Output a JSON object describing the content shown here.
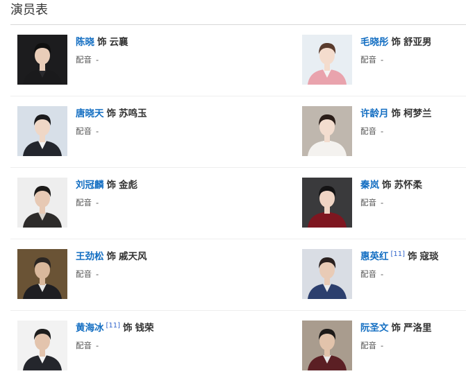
{
  "heading": "演员表",
  "voice_label": "配音",
  "plays_label": "饰",
  "cast": [
    {
      "actor": "陈晓",
      "ref": "",
      "character": "云襄",
      "voice": "-",
      "photo": {
        "bg": "#1c1c1e",
        "hair": "#0f0f0f",
        "skin": "#e9cdb9",
        "outfit": "#1a1a1c",
        "shirt": "#2a2a2e"
      }
    },
    {
      "actor": "毛晓彤",
      "ref": "",
      "character": "舒亚男",
      "voice": "-",
      "photo": {
        "bg": "#e8eef3",
        "hair": "#5a3c2e",
        "skin": "#f4dccd",
        "outfit": "#e9a3ad",
        "shirt": "#f4f4f4"
      }
    },
    {
      "actor": "唐晓天",
      "ref": "",
      "character": "苏鸣玉",
      "voice": "-",
      "photo": {
        "bg": "#d7dfe8",
        "hair": "#1b1b1d",
        "skin": "#efd7c6",
        "outfit": "#23262d",
        "shirt": "#f2f2f2"
      }
    },
    {
      "actor": "许龄月",
      "ref": "",
      "character": "柯梦兰",
      "voice": "-",
      "photo": {
        "bg": "#bfb7ae",
        "hair": "#2a1d18",
        "skin": "#f3ddcf",
        "outfit": "#f4f2ef",
        "shirt": "#f4f2ef"
      }
    },
    {
      "actor": "刘冠麟",
      "ref": "",
      "character": "金彪",
      "voice": "-",
      "photo": {
        "bg": "#eeeeee",
        "hair": "#1c1a19",
        "skin": "#e7c9b4",
        "outfit": "#2d2b2a",
        "shirt": "#d9d3cb"
      }
    },
    {
      "actor": "秦岚",
      "ref": "",
      "character": "苏怀柔",
      "voice": "-",
      "photo": {
        "bg": "#3a3a3c",
        "hair": "#141314",
        "skin": "#efd4c4",
        "outfit": "#7e1620",
        "shirt": "#7e1620"
      }
    },
    {
      "actor": "王劲松",
      "ref": "",
      "character": "戚天风",
      "voice": "-",
      "photo": {
        "bg": "#6a5335",
        "hair": "#2b2623",
        "skin": "#d9b89c",
        "outfit": "#1e1e22",
        "shirt": "#e8e8e8"
      }
    },
    {
      "actor": "惠英红",
      "ref": "[11]",
      "character": "寇琰",
      "voice": "-",
      "photo": {
        "bg": "#d9dde4",
        "hair": "#2a2120",
        "skin": "#e9cbb6",
        "outfit": "#2c3f6e",
        "shirt": "#eaeaea"
      }
    },
    {
      "actor": "黄海冰",
      "ref": "[11]",
      "character": "钱荣",
      "voice": "-",
      "photo": {
        "bg": "#f2f2f2",
        "hair": "#1e1e1e",
        "skin": "#e3c4ad",
        "outfit": "#24262c",
        "shirt": "#f4f4f4"
      }
    },
    {
      "actor": "阮圣文",
      "ref": "",
      "character": "严洛里",
      "voice": "-",
      "photo": {
        "bg": "#a99c8e",
        "hair": "#1d1a18",
        "skin": "#e2c3ab",
        "outfit": "#5b1f24",
        "shirt": "#e9e9e9"
      }
    }
  ]
}
